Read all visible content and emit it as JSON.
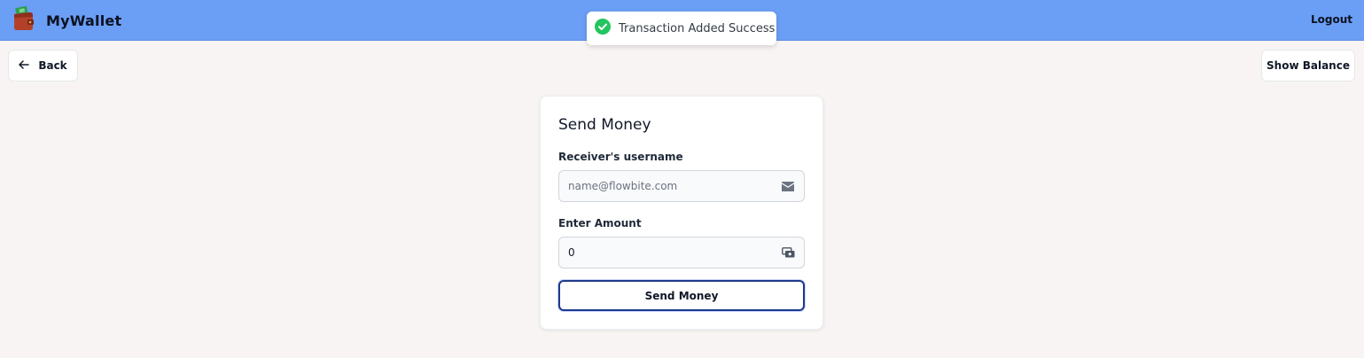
{
  "app": {
    "title": "MyWallet",
    "logo_icon": "wallet-icon",
    "nav_color": "#6b9ef5"
  },
  "header": {
    "logout_label": "Logout"
  },
  "toast": {
    "message": "Transaction Added Success",
    "icon": "check-circle-icon",
    "status_color": "#22c55e"
  },
  "toolbar": {
    "back_label": "Back",
    "back_icon": "arrow-left-icon",
    "show_balance_label": "Show Balance"
  },
  "form": {
    "title": "Send Money",
    "receiver": {
      "label": "Receiver's username",
      "placeholder": "name@flowbite.com",
      "value": "",
      "icon": "envelope-icon"
    },
    "amount": {
      "label": "Enter Amount",
      "value": "0",
      "icon": "money-icon"
    },
    "submit_label": "Send Money",
    "submit_border_color": "#1e3a8a"
  }
}
